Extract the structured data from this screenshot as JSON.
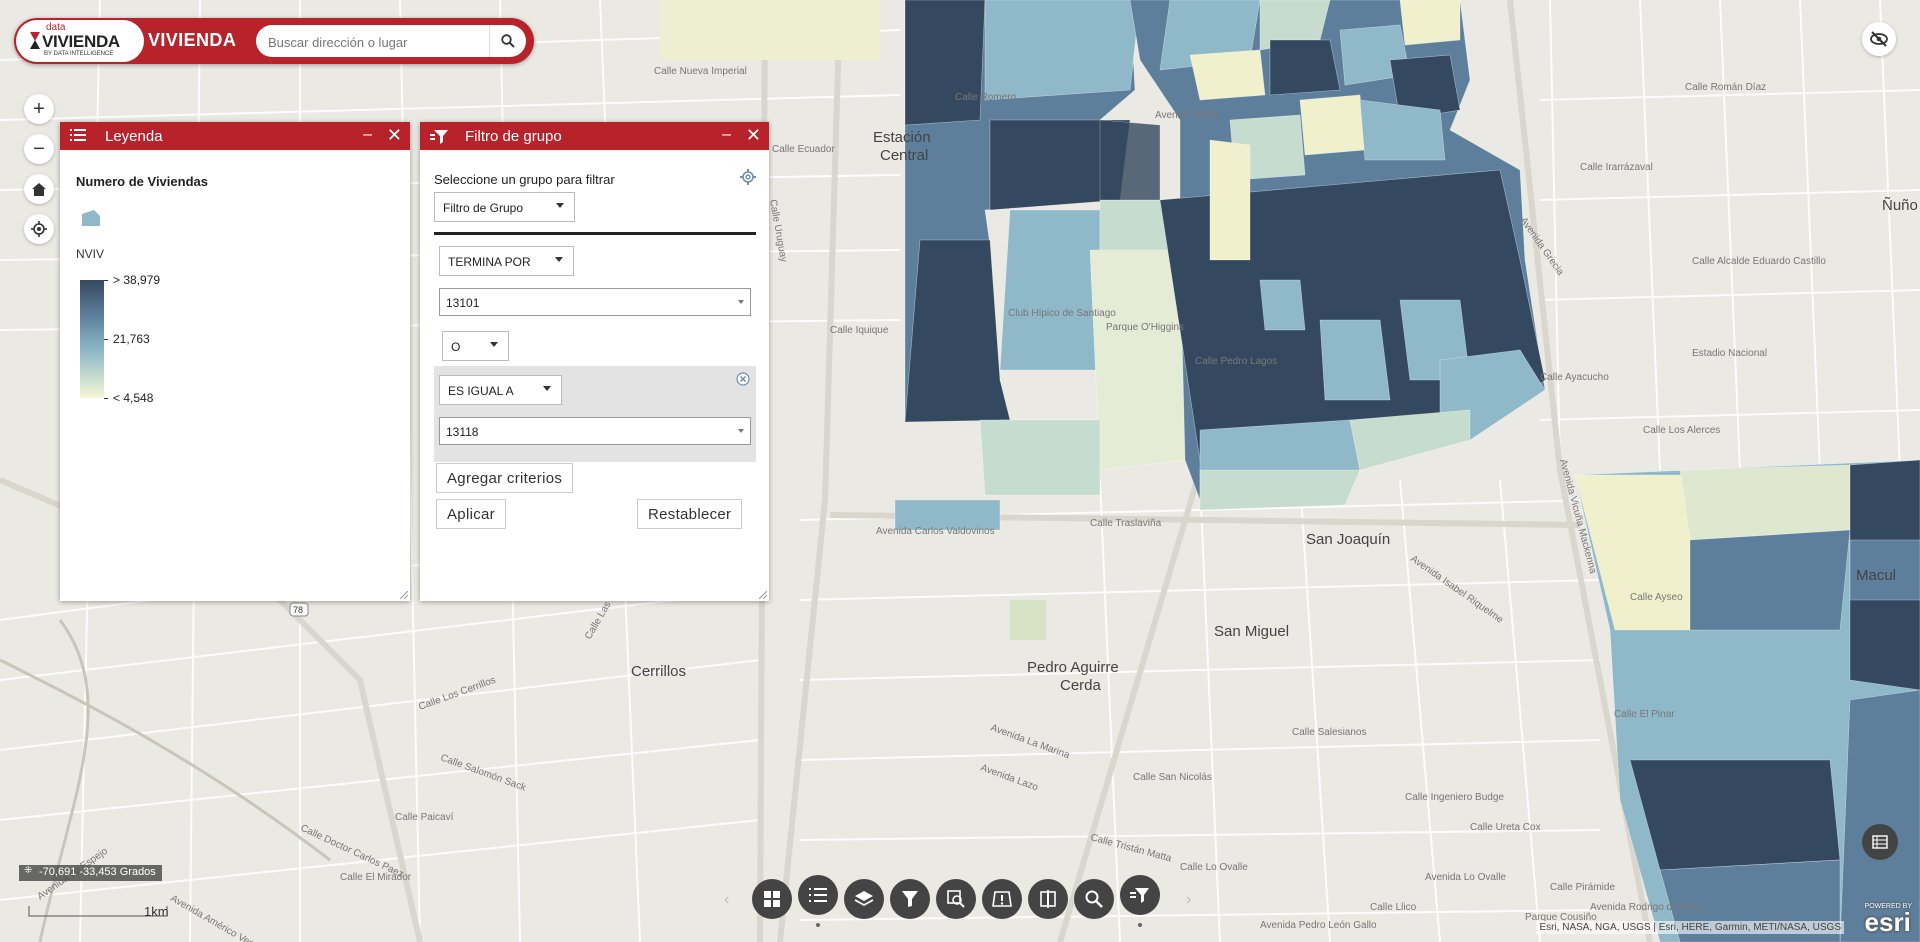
{
  "header": {
    "logo_small": "data",
    "logo_big": "VIVIENDA",
    "logo_sub": "BY DATA INTELLIGENCE",
    "title": "VIVIENDA"
  },
  "search": {
    "placeholder": "Buscar dirección o lugar"
  },
  "legend": {
    "title": "Leyenda",
    "layer_name": "Numero de Viviendas",
    "field": "NVIV",
    "high": "> 38,979",
    "mid": "21,763",
    "low": "< 4,548",
    "ramp_colors": [
      "#34495f",
      "#5e7f9b",
      "#8fb8c8",
      "#c6dccf",
      "#f7f6d6"
    ]
  },
  "filter": {
    "title": "Filtro de grupo",
    "prompt": "Seleccione un grupo para filtrar",
    "group_select": "Filtro de Grupo",
    "operator1": "TERMINA POR",
    "value1": "13101",
    "logic": "O",
    "operator2": "ES IGUAL A",
    "value2": "13118",
    "add_criteria": "Agregar criterios",
    "apply": "Aplicar",
    "reset": "Restablecer"
  },
  "map": {
    "places": {
      "estacion_central_1": "Estación",
      "estacion_central_2": "Central",
      "san_joaquin": "San Joaquín",
      "san_miguel": "San Miguel",
      "pac_1": "Pedro Aguirre",
      "pac_2": "Cerda",
      "cerrillos": "Cerrillos",
      "macul": "Macul",
      "nunoa": "Ñuño"
    },
    "streets": {
      "s1": "Calle Nueva Imperial",
      "s2": "Calle Ecuador",
      "s3": "Calle Iquique",
      "s4": "Avenida Carlos Valdovinos",
      "s5": "Calle Traslaviña",
      "s6": "Avenida Vicuña Mackenna",
      "s7": "Avenida Grecia",
      "s8": "Calle Los Alerces",
      "s9": "Calle El Pinar",
      "s10": "Calle Salesianos",
      "s11": "Calle San Nicolás",
      "s12": "Avenida Lo Ovalle",
      "s13": "Calle Alcalde Eduardo Castillo",
      "s14": "Avenida Rodrigo de Araya",
      "s15": "Estadio Nacional",
      "s16": "Parque O'Higgins",
      "s17": "Club Hípico de Santiago",
      "s18": "Calle Salomón Sack",
      "s19": "Calle Los Cerrillos",
      "s20": "Avenida Lo Espejo",
      "s21": "Calle Doctor Carlos Paez",
      "s22": "Calle El Mirador",
      "s23": "Calle Pedro Lagos",
      "s24": "Calle Ingeniero Budge",
      "s25": "Calle Ureta Cox",
      "s26": "Avenida La Marina",
      "s27": "Avenida Lazo",
      "s28": "Calle Tristán Matta",
      "s29": "Calle Lo Ovalle",
      "s30": "Calle Irarrázaval",
      "s31": "Calle Ayacucho",
      "s32": "Avenida Isabel Riquelme",
      "s33": "Calle Pirámide",
      "s34": "Calle Llico",
      "s35": "Avenida Pedro León Gallo",
      "s36": "Calle Román Díaz",
      "s37": "Parque Cousiño",
      "s38": "Calle Ayseo",
      "s39": "Calle Romero",
      "s40": "Avenida Matta",
      "s41": "Avenida Américo Vespucio",
      "s42": "Calle Las Rosas",
      "s43": "Calle Paicaví",
      "s44": "Calle Uruguay"
    },
    "route_shield": "78",
    "colors": {
      "dark": "#34495f",
      "mid_dark": "#5e7f9b",
      "mid": "#8fb8c8",
      "light": "#c6dccf",
      "pale": "#f0f0cc"
    }
  },
  "coords": "-70,691 -33,453 Grados",
  "scale": "1km",
  "attribution": "Esri, NASA, NGA, USGS | Esri, HERE, Garmin, METI/NASA, USGS",
  "esri_powered": "POWERED BY",
  "esri_brand": "esri",
  "toolbar": {
    "buttons": [
      "grid-icon",
      "legend-list-icon",
      "layers-icon",
      "filter-icon",
      "query-icon",
      "incident-icon",
      "swipe-icon",
      "search-icon",
      "group-filter-icon"
    ]
  }
}
